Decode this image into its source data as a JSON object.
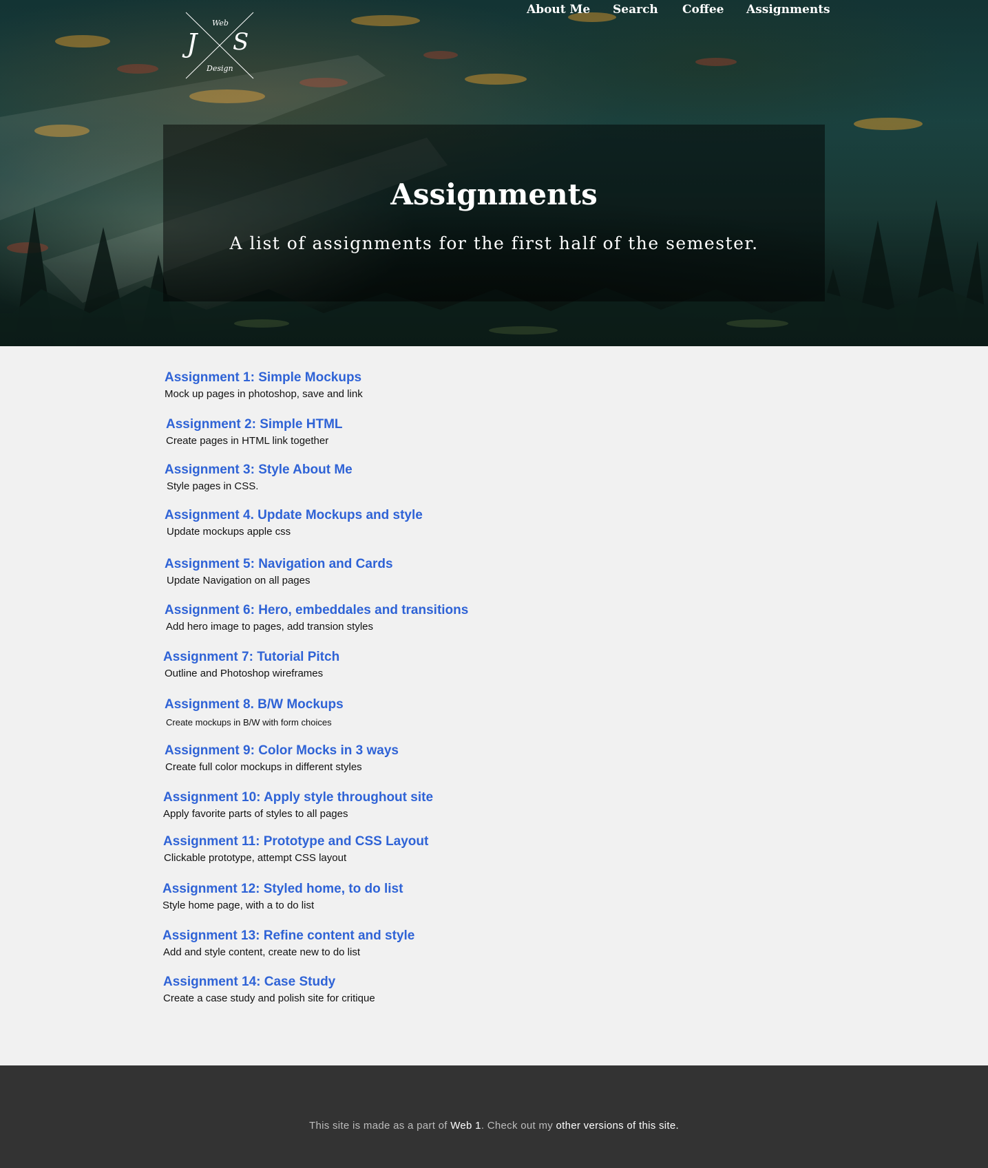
{
  "logo": {
    "letter_left": "J",
    "letter_right": "S",
    "word_top": "Web",
    "word_bottom": "Design"
  },
  "nav": {
    "items": [
      {
        "label": "About Me"
      },
      {
        "label": "Search"
      },
      {
        "label": "Coffee"
      },
      {
        "label": "Assignments"
      }
    ]
  },
  "hero": {
    "title": "Assignments",
    "subtitle": "A list of assignments for the first half of the semester."
  },
  "assignments": [
    {
      "title": "Assignment 1: Simple Mockups",
      "description": "Mock up pages in photoshop, save and link"
    },
    {
      "title": "Assignment 2: Simple HTML",
      "description": "Create pages in HTML link together"
    },
    {
      "title": "Assignment 3: Style About Me",
      "description": "Style pages in CSS."
    },
    {
      "title": "Assignment 4. Update Mockups and style",
      "description": "Update mockups apple css"
    },
    {
      "title": "Assignment 5: Navigation and Cards",
      "description": "Update Navigation on all pages"
    },
    {
      "title": "Assignment 6: Hero, embeddales and transitions",
      "description": "Add hero image to pages, add transion styles"
    },
    {
      "title": "Assignment 7: Tutorial Pitch",
      "description": "Outline and Photoshop wireframes"
    },
    {
      "title": "Assignment 8. B/W Mockups",
      "description": "Create mockups in B/W with form choices"
    },
    {
      "title": "Assignment 9: Color Mocks in 3 ways",
      "description": "Create full color mockups in different styles"
    },
    {
      "title": "Assignment 10: Apply style throughout site",
      "description": "Apply favorite parts of styles to all pages"
    },
    {
      "title": "Assignment 11: Prototype and CSS Layout",
      "description": "Clickable prototype, attempt CSS layout"
    },
    {
      "title": "Assignment 12: Styled home, to do list",
      "description": "Style home page, with a to do list"
    },
    {
      "title": "Assignment 13: Refine content and style",
      "description": "Add and style content, create new to do list"
    },
    {
      "title": "Assignment 14: Case Study",
      "description": "Create a case study and polish site for critique"
    }
  ],
  "footer": {
    "text_1": "This site is made as a part of ",
    "link_1": "Web 1",
    "text_2": ". Check out my ",
    "link_2": "other versions of this site",
    "text_3": "."
  },
  "colors": {
    "link_blue": "#2f63d6",
    "page_background": "#f1f1f1",
    "footer_background": "#333333"
  }
}
